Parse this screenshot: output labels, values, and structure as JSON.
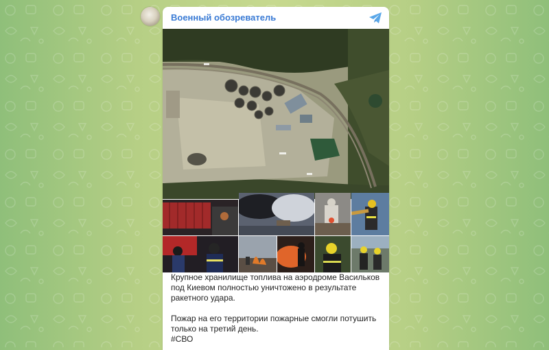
{
  "post": {
    "channel_name": "Военный обозреватель",
    "caption_line1": "Крупное хранилище топлива на аэродроме Васильков под Киевом полностью уничтожено в результате ракетного удара.",
    "caption_line2": "Пожар на его территории пожарные смогли потушить только на третий день.",
    "hashtag": "#СВО"
  },
  "icons": {
    "share": "telegram-paper-plane-icon"
  },
  "colors": {
    "channel_name": "#3a7bd5",
    "background_center": "#c7d98f",
    "background_edge": "#8fbf7a"
  }
}
